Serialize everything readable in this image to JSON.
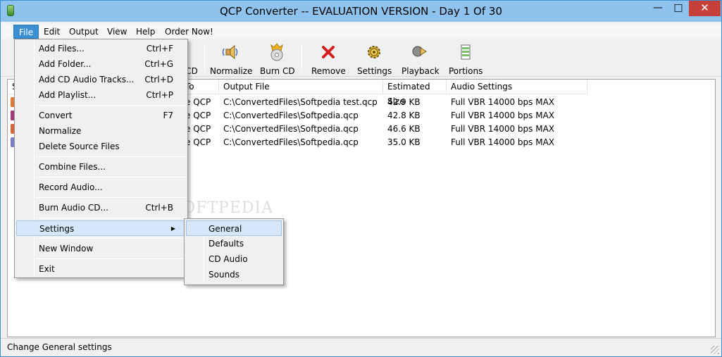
{
  "window": {
    "title": "QCP Converter -- EVALUATION VERSION - Day 1 Of 30"
  },
  "titlebar_buttons": {
    "minimize": "—",
    "maximize": "□",
    "close": "✕"
  },
  "menubar": {
    "items": [
      {
        "label": "File"
      },
      {
        "label": "Edit"
      },
      {
        "label": "Output"
      },
      {
        "label": "View"
      },
      {
        "label": "Help"
      },
      {
        "label": "Order Now!"
      }
    ]
  },
  "toolbar": {
    "items": [
      {
        "label": "CD",
        "icon": "burn-partial-icon"
      },
      {
        "label": "Normalize",
        "icon": "speaker-icon"
      },
      {
        "label": "Burn CD",
        "icon": "burn-cd-icon"
      },
      {
        "label": "Remove",
        "icon": "red-x-icon"
      },
      {
        "label": "Settings",
        "icon": "gear-icon"
      },
      {
        "label": "Playback",
        "icon": "playback-icon"
      },
      {
        "label": "Portions",
        "icon": "portions-icon"
      }
    ]
  },
  "list": {
    "headers": [
      "S",
      "To",
      "Output File",
      "Estimated Size",
      "Audio Settings"
    ],
    "rows": [
      {
        "to": "e QCP",
        "output": "C:\\ConvertedFiles\\Softpedia test.qcp",
        "size": "42.9 KB",
        "settings": "Full VBR 14000 bps MAX"
      },
      {
        "to": "e QCP",
        "output": "C:\\ConvertedFiles\\Softpedia.qcp",
        "size": "42.8 KB",
        "settings": "Full VBR 14000 bps MAX"
      },
      {
        "to": "e QCP",
        "output": "C:\\ConvertedFiles\\Softpedia.qcp",
        "size": "46.6 KB",
        "settings": "Full VBR 14000 bps MAX"
      },
      {
        "to": "e QCP",
        "output": "C:\\ConvertedFiles\\Softpedia.qcp",
        "size": "35.0 KB",
        "settings": "Full VBR 14000 bps MAX"
      }
    ],
    "row_icon_colors": [
      "#e07b39",
      "#a33d7a",
      "#d9653a",
      "#7b7fc6"
    ]
  },
  "file_menu": {
    "items": [
      {
        "label": "Add Files...",
        "shortcut": "Ctrl+F"
      },
      {
        "label": "Add Folder...",
        "shortcut": "Ctrl+G"
      },
      {
        "label": "Add CD Audio Tracks...",
        "shortcut": "Ctrl+D"
      },
      {
        "label": "Add Playlist...",
        "shortcut": "Ctrl+P"
      },
      {
        "label": "Convert",
        "shortcut": "F7"
      },
      {
        "label": "Normalize",
        "shortcut": ""
      },
      {
        "label": "Delete Source Files",
        "shortcut": ""
      },
      {
        "label": "Combine Files...",
        "shortcut": ""
      },
      {
        "label": "Record Audio...",
        "shortcut": ""
      },
      {
        "label": "Burn Audio CD...",
        "shortcut": "Ctrl+B"
      },
      {
        "label": "Settings",
        "shortcut": ""
      },
      {
        "label": "New Window",
        "shortcut": ""
      },
      {
        "label": "Exit",
        "shortcut": ""
      }
    ],
    "settings_arrow": "▶"
  },
  "settings_submenu": {
    "items": [
      {
        "label": "General"
      },
      {
        "label": "Defaults"
      },
      {
        "label": "CD Audio"
      },
      {
        "label": "Sounds"
      }
    ]
  },
  "watermark": "SOFTPEDIA",
  "status": {
    "text": "Change General settings"
  },
  "colors": {
    "accent": "#3c8fd0",
    "title_bg": "#8fc3ee",
    "close": "#c7413a",
    "highlight": "#d5e7f8"
  }
}
